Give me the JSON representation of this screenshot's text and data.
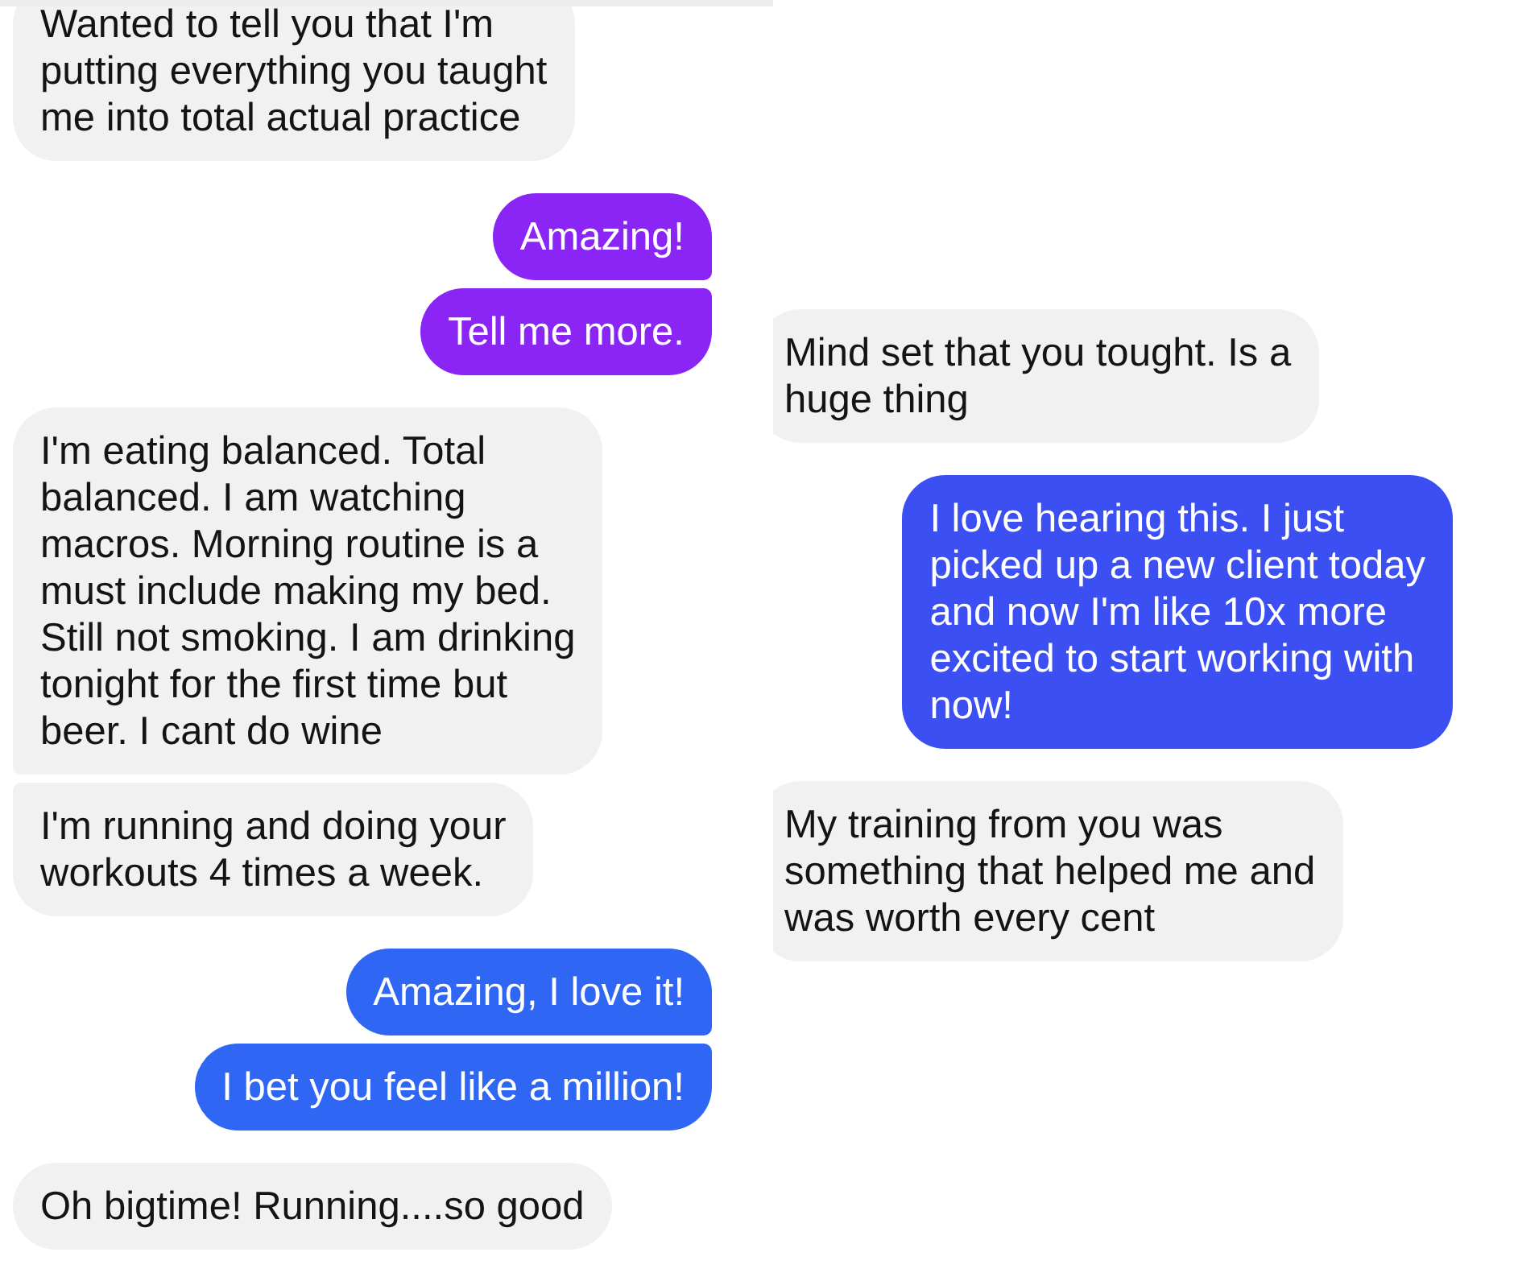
{
  "conversations": [
    {
      "messages": [
        {
          "kind": "received",
          "text": "Wanted to tell you that I'm\nputting everything you taught\nme into total actual practice"
        },
        {
          "kind": "sent",
          "color": "#8b25f6",
          "text": "Amazing!"
        },
        {
          "kind": "sent",
          "color": "#8b25f6",
          "text": "Tell me more."
        },
        {
          "kind": "received",
          "text": "I'm eating balanced. Total\nbalanced. I am watching\nmacros. Morning routine is a\nmust include making my bed.\nStill not smoking. I am drinking\ntonight for the first time but\nbeer. I cant do wine"
        },
        {
          "kind": "received",
          "text": "I'm running and doing your\nworkouts 4 times a week."
        },
        {
          "kind": "sent",
          "color": "#2f66f3",
          "text": "Amazing, I love it!"
        },
        {
          "kind": "sent",
          "color": "#2f66f3",
          "text": "I bet you feel like a million!"
        },
        {
          "kind": "received",
          "text": "Oh bigtime! Running....so good"
        }
      ]
    },
    {
      "messages": [
        {
          "kind": "received",
          "text": "Mind set that you tought. Is a\nhuge thing"
        },
        {
          "kind": "sent",
          "color": "#3b4ff2",
          "text": "I love hearing this. I just\npicked up a new client today\nand now I'm like 10x more\nexcited to start working with\nnow!"
        },
        {
          "kind": "received",
          "text": "My training from you was\nsomething that helped me and\nwas worth every cent"
        }
      ]
    }
  ]
}
